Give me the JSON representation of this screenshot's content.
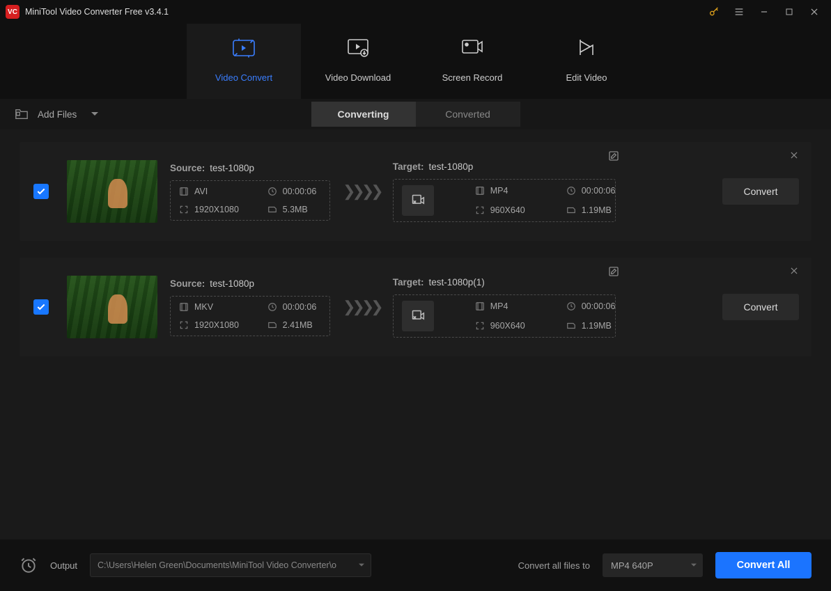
{
  "titlebar": {
    "title": "MiniTool Video Converter Free v3.4.1"
  },
  "nav": {
    "convert": "Video Convert",
    "download": "Video Download",
    "record": "Screen Record",
    "edit": "Edit Video"
  },
  "toolbar": {
    "add_files": "Add Files",
    "converting": "Converting",
    "converted": "Converted"
  },
  "labels": {
    "source": "Source:",
    "target": "Target:",
    "convert": "Convert"
  },
  "rows": [
    {
      "source_name": "test-1080p",
      "src_fmt": "AVI",
      "src_dur": "00:00:06",
      "src_res": "1920X1080",
      "src_size": "5.3MB",
      "target_name": "test-1080p",
      "tgt_fmt": "MP4",
      "tgt_dur": "00:00:06",
      "tgt_res": "960X640",
      "tgt_size": "1.19MB"
    },
    {
      "source_name": "test-1080p",
      "src_fmt": "MKV",
      "src_dur": "00:00:06",
      "src_res": "1920X1080",
      "src_size": "2.41MB",
      "target_name": "test-1080p(1)",
      "tgt_fmt": "MP4",
      "tgt_dur": "00:00:06",
      "tgt_res": "960X640",
      "tgt_size": "1.19MB"
    }
  ],
  "footer": {
    "output_label": "Output",
    "output_path": "C:\\Users\\Helen Green\\Documents\\MiniTool Video Converter\\o",
    "convert_all_label": "Convert all files to",
    "preset": "MP4 640P",
    "convert_all": "Convert All"
  }
}
